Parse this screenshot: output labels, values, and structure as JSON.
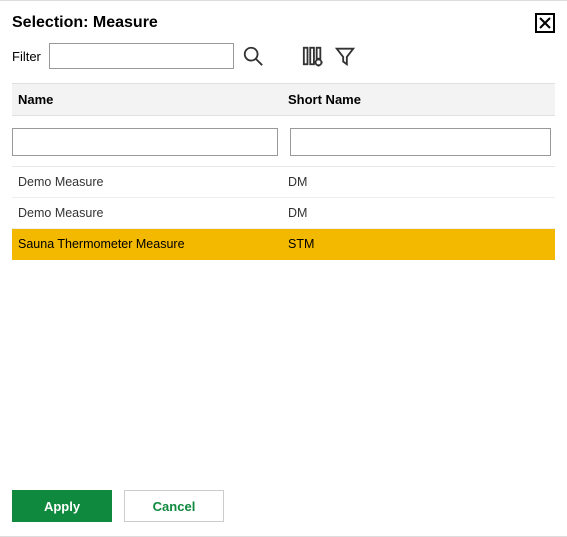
{
  "dialog": {
    "title": "Selection: Measure"
  },
  "filter": {
    "label": "Filter",
    "value": ""
  },
  "table": {
    "headers": {
      "name": "Name",
      "short_name": "Short Name"
    },
    "column_filter": {
      "name": "",
      "short_name": ""
    },
    "rows": [
      {
        "name": "Demo Measure",
        "short_name": "DM",
        "selected": false
      },
      {
        "name": "Demo Measure",
        "short_name": "DM",
        "selected": false
      },
      {
        "name": "Sauna Thermometer Measure",
        "short_name": "STM",
        "selected": true
      }
    ]
  },
  "buttons": {
    "apply": "Apply",
    "cancel": "Cancel"
  }
}
